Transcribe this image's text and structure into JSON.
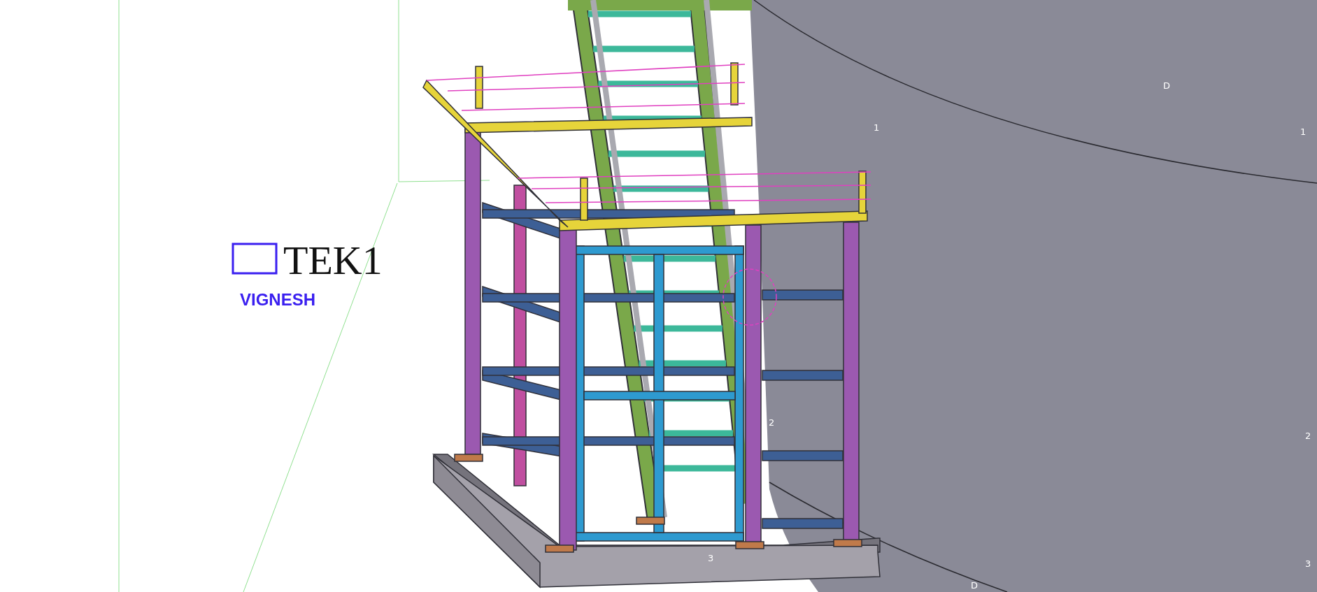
{
  "viewport": {
    "logo": {
      "brand": "TEK1",
      "caption": "VIGNESH"
    },
    "grid_labels": [
      "D",
      "1",
      "1",
      "2",
      "2",
      "3",
      "3",
      "D"
    ]
  }
}
